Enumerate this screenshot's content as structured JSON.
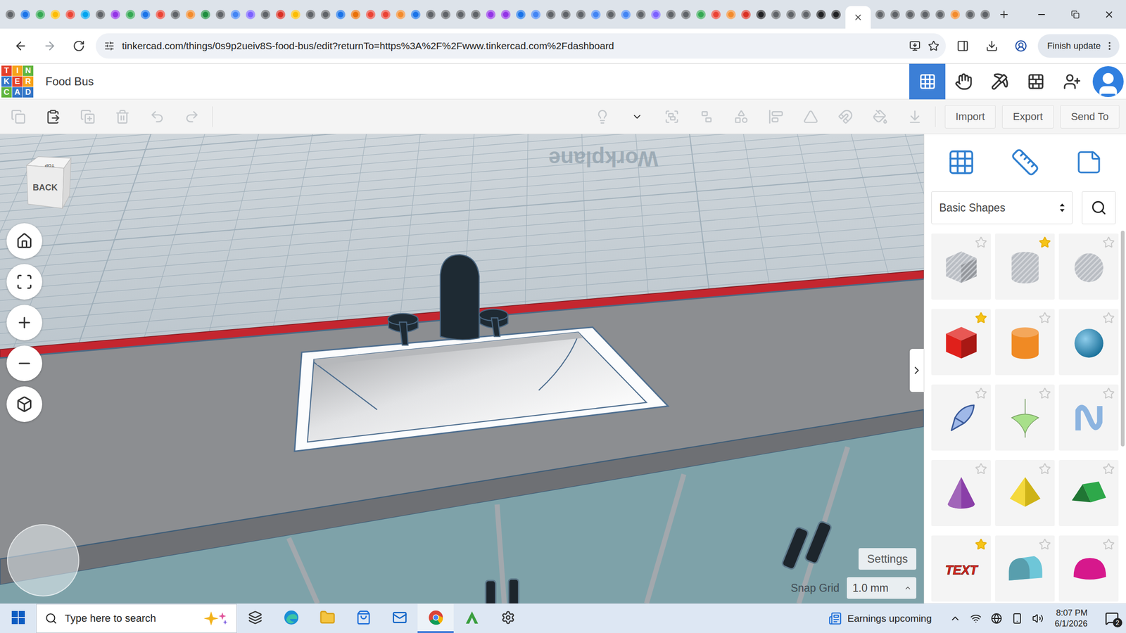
{
  "browser": {
    "tabs": [
      {
        "color": "#5f6368",
        "selected": false
      },
      {
        "color": "#1a73e8",
        "selected": false
      },
      {
        "color": "#34a853",
        "selected": false
      },
      {
        "color": "#fbbc04",
        "selected": false
      },
      {
        "color": "#ea4335",
        "selected": false
      },
      {
        "color": "#00a4ef",
        "selected": false
      },
      {
        "color": "#5f6368",
        "selected": false
      },
      {
        "color": "#9334e6",
        "selected": false
      },
      {
        "color": "#34a853",
        "selected": false
      },
      {
        "color": "#1a73e8",
        "selected": false
      },
      {
        "color": "#ea4335",
        "selected": false
      },
      {
        "color": "#5f6368",
        "selected": false
      },
      {
        "color": "#f28b2d",
        "selected": false
      },
      {
        "color": "#1e8e3e",
        "selected": false
      },
      {
        "color": "#5f6368",
        "selected": false
      },
      {
        "color": "#4285f4",
        "selected": false
      },
      {
        "color": "#7b61ff",
        "selected": false
      },
      {
        "color": "#5f6368",
        "selected": false
      },
      {
        "color": "#d93025",
        "selected": false
      },
      {
        "color": "#fbbc04",
        "selected": false
      },
      {
        "color": "#5f6368",
        "selected": false
      },
      {
        "color": "#5f6368",
        "selected": false
      },
      {
        "color": "#1a73e8",
        "selected": false
      },
      {
        "color": "#e8710a",
        "selected": false
      },
      {
        "color": "#ea4335",
        "selected": false
      },
      {
        "color": "#ea4335",
        "selected": false
      },
      {
        "color": "#f28b2d",
        "selected": false
      },
      {
        "color": "#1a73e8",
        "selected": false
      },
      {
        "color": "#5f6368",
        "selected": false
      },
      {
        "color": "#5f6368",
        "selected": false
      },
      {
        "color": "#5f6368",
        "selected": false
      },
      {
        "color": "#5f6368",
        "selected": false
      },
      {
        "color": "#9334e6",
        "selected": false
      },
      {
        "color": "#9334e6",
        "selected": false
      },
      {
        "color": "#1a73e8",
        "selected": false
      },
      {
        "color": "#4285f4",
        "selected": false
      },
      {
        "color": "#5f6368",
        "selected": false
      },
      {
        "color": "#5f6368",
        "selected": false
      },
      {
        "color": "#5f6368",
        "selected": false
      },
      {
        "color": "#4285f4",
        "selected": false
      },
      {
        "color": "#5f6368",
        "selected": false
      },
      {
        "color": "#4285f4",
        "selected": false
      },
      {
        "color": "#5f6368",
        "selected": false
      },
      {
        "color": "#7b61ff",
        "selected": false
      },
      {
        "color": "#5f6368",
        "selected": false
      },
      {
        "color": "#5f6368",
        "selected": false
      },
      {
        "color": "#34a853",
        "selected": false
      },
      {
        "color": "#ea4335",
        "selected": false
      },
      {
        "color": "#f28b2d",
        "selected": false
      },
      {
        "color": "#d93025",
        "selected": false
      },
      {
        "color": "#202124",
        "selected": false
      },
      {
        "color": "#5f6368",
        "selected": false
      },
      {
        "color": "#5f6368",
        "selected": false
      },
      {
        "color": "#5f6368",
        "selected": false
      },
      {
        "color": "#202124",
        "selected": false
      },
      {
        "color": "#202124",
        "selected": false
      },
      {
        "selected": true
      },
      {
        "color": "#5f6368",
        "selected": false
      },
      {
        "color": "#5f6368",
        "selected": false
      },
      {
        "color": "#5f6368",
        "selected": false
      },
      {
        "color": "#5f6368",
        "selected": false
      },
      {
        "color": "#5f6368",
        "selected": false
      },
      {
        "color": "#f28b2d",
        "selected": false
      },
      {
        "color": "#5f6368",
        "selected": false
      },
      {
        "color": "#5f6368",
        "selected": false
      }
    ],
    "url": "tinkercad.com/things/0s9p2ueiv8S-food-bus/edit?returnTo=https%3A%2F%2Fwww.tinkercad.com%2Fdashboard",
    "update_button": "Finish update"
  },
  "app": {
    "logo": [
      {
        "letter": "T",
        "color": "#e4412b"
      },
      {
        "letter": "I",
        "color": "#f7a21b"
      },
      {
        "letter": "N",
        "color": "#62b53f"
      },
      {
        "letter": "K",
        "color": "#3577c7"
      },
      {
        "letter": "E",
        "color": "#e4412b"
      },
      {
        "letter": "R",
        "color": "#f7a21b"
      },
      {
        "letter": "C",
        "color": "#62b53f"
      },
      {
        "letter": "A",
        "color": "#3577c7"
      },
      {
        "letter": "D",
        "color": "#3577c7"
      }
    ],
    "title": "Food Bus",
    "header_buttons": [
      {
        "kind": "grid",
        "selected": true
      },
      {
        "kind": "sim",
        "selected": false
      },
      {
        "kind": "build",
        "selected": false
      },
      {
        "kind": "bricks",
        "selected": false
      },
      {
        "kind": "invite",
        "selected": false
      },
      {
        "kind": "profile",
        "selected": false
      }
    ]
  },
  "toolbar": {
    "edit_tools": [
      {
        "kind": "copy",
        "disabled": true
      },
      {
        "kind": "paste",
        "disabled": false
      },
      {
        "kind": "duplicate",
        "disabled": true
      },
      {
        "kind": "delete",
        "disabled": true
      },
      {
        "kind": "undo",
        "disabled": true
      },
      {
        "kind": "redo",
        "disabled": true
      }
    ],
    "view_tools": [
      {
        "kind": "notes",
        "disabled": true
      },
      {
        "kind": "notes-menu",
        "disabled": false
      },
      {
        "kind": "group",
        "disabled": true
      },
      {
        "kind": "ungroup",
        "disabled": true
      },
      {
        "kind": "shape",
        "disabled": true
      },
      {
        "kind": "align",
        "disabled": true
      },
      {
        "kind": "mirror",
        "disabled": true
      },
      {
        "kind": "cruise",
        "disabled": true
      },
      {
        "kind": "paint",
        "disabled": true
      },
      {
        "kind": "drop",
        "disabled": true
      }
    ],
    "buttons": [
      "Import",
      "Export",
      "Send To"
    ]
  },
  "viewport": {
    "view_cube": {
      "top": "TOP",
      "face": "BACK"
    },
    "workplane_label": "Workplane",
    "nav_buttons": [
      {
        "kind": "home"
      },
      {
        "kind": "fit"
      },
      {
        "kind": "zoom-in"
      },
      {
        "kind": "zoom-out"
      },
      {
        "kind": "perspective"
      }
    ],
    "settings_button": "Settings",
    "snap_grid": {
      "label": "Snap Grid",
      "value": "1.0 mm"
    }
  },
  "shapes_panel": {
    "category": "Basic Shapes",
    "shapes": [
      {
        "kind": "box",
        "color": "#b9bdc3",
        "hole": true,
        "favorite": false
      },
      {
        "kind": "cylinder",
        "color": "#b9bdc3",
        "hole": true,
        "favorite": true
      },
      {
        "kind": "sphere",
        "color": "#b9bdc3",
        "hole": true,
        "favorite": false
      },
      {
        "kind": "box",
        "color": "#e0201b",
        "hole": false,
        "favorite": true
      },
      {
        "kind": "cylinder",
        "color": "#f08a24",
        "hole": false,
        "favorite": false
      },
      {
        "kind": "sphere",
        "color": "#1e9bd7",
        "hole": false,
        "favorite": false
      },
      {
        "kind": "scribble",
        "color": "#9fb8e8",
        "hole": false,
        "favorite": false
      },
      {
        "kind": "paraboloid",
        "color": "#a8e08a",
        "hole": false,
        "favorite": false
      },
      {
        "kind": "wave",
        "color": "#8cb4e0",
        "hole": false,
        "favorite": false
      },
      {
        "kind": "cone",
        "color": "#8a3fa8",
        "hole": false,
        "favorite": false
      },
      {
        "kind": "pyramid",
        "color": "#f2d21b",
        "hole": false,
        "favorite": false
      },
      {
        "kind": "roof",
        "color": "#2ea84a",
        "hole": false,
        "favorite": false
      },
      {
        "kind": "text",
        "label": "TEXT",
        "color": "#d9251d",
        "hole": false,
        "favorite": true
      },
      {
        "kind": "half-cylinder",
        "color": "#6ec6d8",
        "hole": false,
        "favorite": false
      },
      {
        "kind": "half-sphere",
        "color": "#d6188c",
        "hole": false,
        "favorite": false
      }
    ]
  },
  "taskbar": {
    "search_placeholder": "Type here to search",
    "apps": [
      {
        "kind": "task-view",
        "selected": false
      },
      {
        "kind": "edge",
        "selected": false
      },
      {
        "kind": "explorer",
        "selected": false
      },
      {
        "kind": "store",
        "selected": false
      },
      {
        "kind": "outlook",
        "selected": false
      },
      {
        "kind": "chrome",
        "selected": true
      },
      {
        "kind": "autodesk",
        "selected": false
      },
      {
        "kind": "settings",
        "selected": false
      }
    ],
    "news": "Earnings upcoming",
    "time": "8:07 PM",
    "date": "6/1/2026",
    "notifications": "2"
  }
}
